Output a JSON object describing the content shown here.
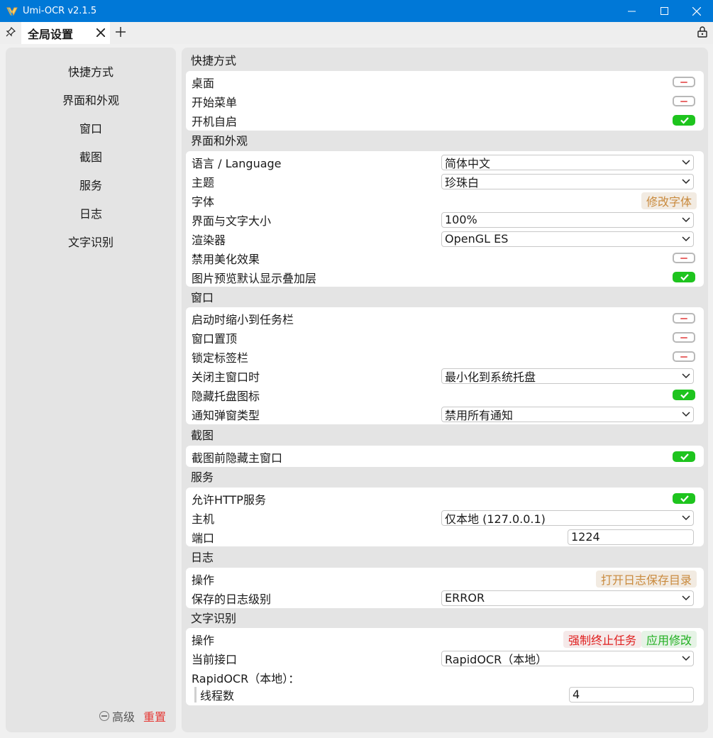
{
  "window": {
    "title": "Umi-OCR v2.1.5",
    "icons": [
      "app-icon",
      "minimize-icon",
      "maximize-icon",
      "close-icon"
    ]
  },
  "tabs": {
    "active_tab": "全局设置",
    "icons": [
      "pin-icon",
      "close-icon",
      "plus-icon",
      "lock-icon"
    ]
  },
  "sidebar": {
    "items": [
      {
        "label": "快捷方式"
      },
      {
        "label": "界面和外观"
      },
      {
        "label": "窗口"
      },
      {
        "label": "截图"
      },
      {
        "label": "服务"
      },
      {
        "label": "日志"
      },
      {
        "label": "文字识别"
      }
    ],
    "advanced_label": "高级",
    "reset_label": "重置"
  },
  "colors": {
    "titlebar": "#0078d7",
    "toggle_on": "#1ec41e",
    "toggle_off_mark": "#e86a6a",
    "orange_button_text": "#c98a3d",
    "red_button_text": "#e02020",
    "green_button_text": "#22b022"
  },
  "sections": {
    "shortcuts": {
      "title": "快捷方式",
      "desktop": {
        "label": "桌面",
        "value": false
      },
      "start_menu": {
        "label": "开始菜单",
        "value": false
      },
      "autostart": {
        "label": "开机自启",
        "value": true
      }
    },
    "appearance": {
      "title": "界面和外观",
      "language": {
        "label": "语言 / Language",
        "value": "简体中文"
      },
      "theme": {
        "label": "主题",
        "value": "珍珠白"
      },
      "font": {
        "label": "字体",
        "button": "修改字体"
      },
      "scale": {
        "label": "界面与文字大小",
        "value": "100%"
      },
      "renderer": {
        "label": "渲染器",
        "value": "OpenGL ES"
      },
      "disable_effects": {
        "label": "禁用美化效果",
        "value": false
      },
      "preview_overlay": {
        "label": "图片预览默认显示叠加层",
        "value": true
      }
    },
    "window": {
      "title": "窗口",
      "minimize_on_start": {
        "label": "启动时缩小到任务栏",
        "value": false
      },
      "topmost": {
        "label": "窗口置顶",
        "value": false
      },
      "lock_tabbar": {
        "label": "锁定标签栏",
        "value": false
      },
      "on_close": {
        "label": "关闭主窗口时",
        "value": "最小化到系统托盘"
      },
      "hide_tray": {
        "label": "隐藏托盘图标",
        "value": true
      },
      "notify_type": {
        "label": "通知弹窗类型",
        "value": "禁用所有通知"
      }
    },
    "screenshot": {
      "title": "截图",
      "hide_main": {
        "label": "截图前隐藏主窗口",
        "value": true
      }
    },
    "service": {
      "title": "服务",
      "allow_http": {
        "label": "允许HTTP服务",
        "value": true
      },
      "host": {
        "label": "主机",
        "value": "仅本地 (127.0.0.1)"
      },
      "port": {
        "label": "端口",
        "value": "1224"
      }
    },
    "log": {
      "title": "日志",
      "action": {
        "label": "操作",
        "button": "打开日志保存目录"
      },
      "level": {
        "label": "保存的日志级别",
        "value": "ERROR"
      }
    },
    "ocr": {
      "title": "文字识别",
      "action": {
        "label": "操作",
        "stop_button": "强制终止任务",
        "apply_button": "应用修改"
      },
      "interface": {
        "label": "当前接口",
        "value": "RapidOCR（本地）"
      },
      "sub_title": "RapidOCR（本地）：",
      "threads": {
        "label": "线程数",
        "value": "4"
      }
    }
  }
}
